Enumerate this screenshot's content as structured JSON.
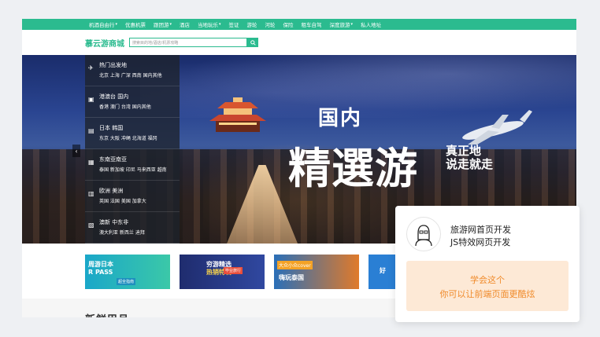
{
  "topnav": {
    "items": [
      {
        "label": "机酒自由行",
        "dropdown": true
      },
      {
        "label": "优惠机票",
        "dropdown": false
      },
      {
        "label": "跟团游",
        "dropdown": true
      },
      {
        "label": "酒店",
        "dropdown": false
      },
      {
        "label": "当地玩乐",
        "dropdown": true
      },
      {
        "label": "签证",
        "dropdown": false
      },
      {
        "label": "游轮",
        "dropdown": false
      },
      {
        "label": "河轮",
        "dropdown": false
      },
      {
        "label": "保险",
        "dropdown": false
      },
      {
        "label": "租车自驾",
        "dropdown": false
      },
      {
        "label": "深度旅游",
        "dropdown": true
      },
      {
        "label": "私人地址",
        "dropdown": false
      }
    ],
    "caret": "▾"
  },
  "header": {
    "logo": "慕云游商城",
    "search_placeholder": "搜索目的地/酒店/机票攻略"
  },
  "sidemenu": [
    {
      "title": "热门出发地",
      "sub": "北京 上海 广深 西南 国内其他",
      "icon": "plane-icon",
      "glyph": "✈"
    },
    {
      "title": "港澳台 国内",
      "sub": "香港 澳门 台湾 国内其他",
      "icon": "suitcase-icon",
      "glyph": "▣"
    },
    {
      "title": "日本 韩国",
      "sub": "东京 大阪 冲绳 北海道 福冈",
      "icon": "photo-icon",
      "glyph": "▤"
    },
    {
      "title": "东南亚南亚",
      "sub": "泰国 新加坡 印尼 马来西亚 越南",
      "icon": "map-icon",
      "glyph": "▦"
    },
    {
      "title": "欧洲 美洲",
      "sub": "英国 法国 美国 加拿大",
      "icon": "ticket-icon",
      "glyph": "▥"
    },
    {
      "title": "澳新 中东非",
      "sub": "澳大利亚 新西兰 迪拜",
      "icon": "calendar-icon",
      "glyph": "▧"
    }
  ],
  "hero": {
    "line1": "国内",
    "line2": "精選游",
    "line3a": "真正地",
    "line3b": "说走就走",
    "prev": "‹",
    "slide_count": 5
  },
  "promos": [
    {
      "line1": "周游日本",
      "line2": "R PASS",
      "tag": "超全指南"
    },
    {
      "line1": "穷游精选",
      "line2": "热销特辑",
      "tag": "毕业旅行"
    },
    {
      "line1": "大众小众cover",
      "line2": "嗨玩泰国"
    },
    {
      "line1": "好"
    }
  ],
  "section": {
    "title": "新鲜甲月"
  },
  "card": {
    "line1": "旅游网首页开发",
    "line2": "JS特效网页开发",
    "note1": "学会这个",
    "note2": "你可以让前端页面更酷炫"
  },
  "colors": {
    "accent": "#2bbb8f",
    "note_bg": "#fde9d6",
    "note_text": "#f08a2a"
  }
}
